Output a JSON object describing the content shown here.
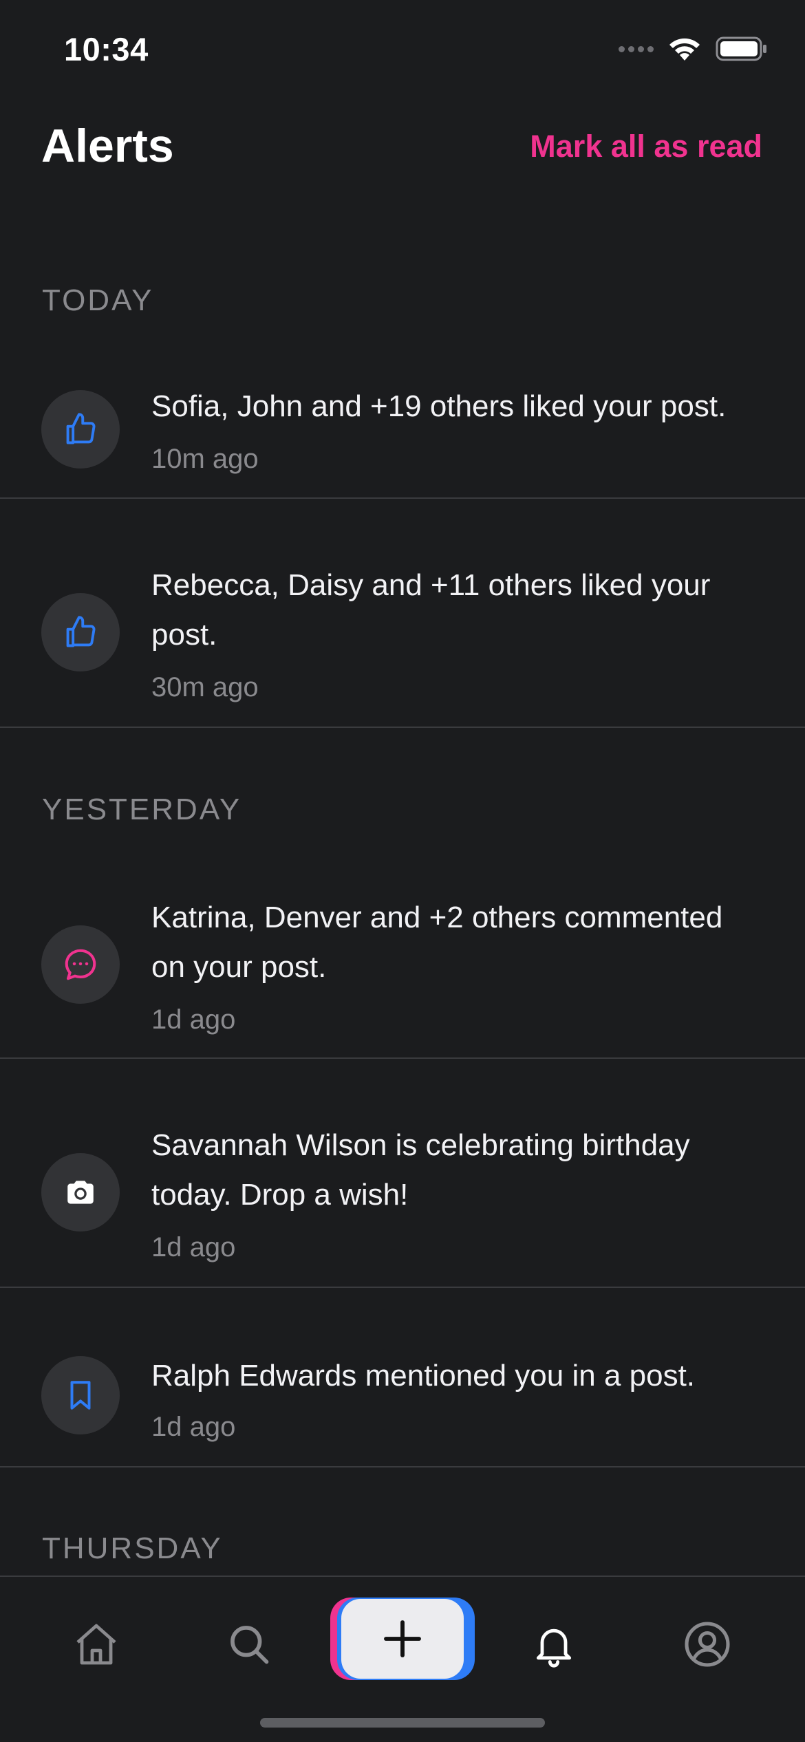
{
  "status_bar": {
    "time": "10:34"
  },
  "header": {
    "title": "Alerts",
    "mark_all_label": "Mark all as read"
  },
  "sections": [
    {
      "label": "TODAY"
    },
    {
      "label": "YESTERDAY"
    },
    {
      "label": "THURSDAY"
    }
  ],
  "alerts": [
    {
      "icon": "thumbs-up-icon",
      "text": "Sofia, John and +19 others liked your post.",
      "time": "10m ago"
    },
    {
      "icon": "thumbs-up-icon",
      "text": "Rebecca, Daisy and +11 others liked your post.",
      "time": "30m ago"
    },
    {
      "icon": "comment-icon",
      "text": "Katrina, Denver and +2 others commented on your post.",
      "time": "1d ago"
    },
    {
      "icon": "camera-icon",
      "text": "Savannah Wilson is celebrating birthday today. Drop a wish!",
      "time": "1d ago"
    },
    {
      "icon": "bookmark-icon",
      "text": "Ralph Edwards mentioned you in a post.",
      "time": "1d ago"
    }
  ],
  "tab_bar": {
    "items": [
      "home-icon",
      "search-icon",
      "plus-icon",
      "bell-icon",
      "profile-icon"
    ]
  },
  "colors": {
    "background": "#1b1c1e",
    "accent_pink": "#f0338f",
    "accent_blue": "#2e7cf6",
    "divider": "#3a3b3e",
    "muted_text": "#8a8a8e"
  }
}
